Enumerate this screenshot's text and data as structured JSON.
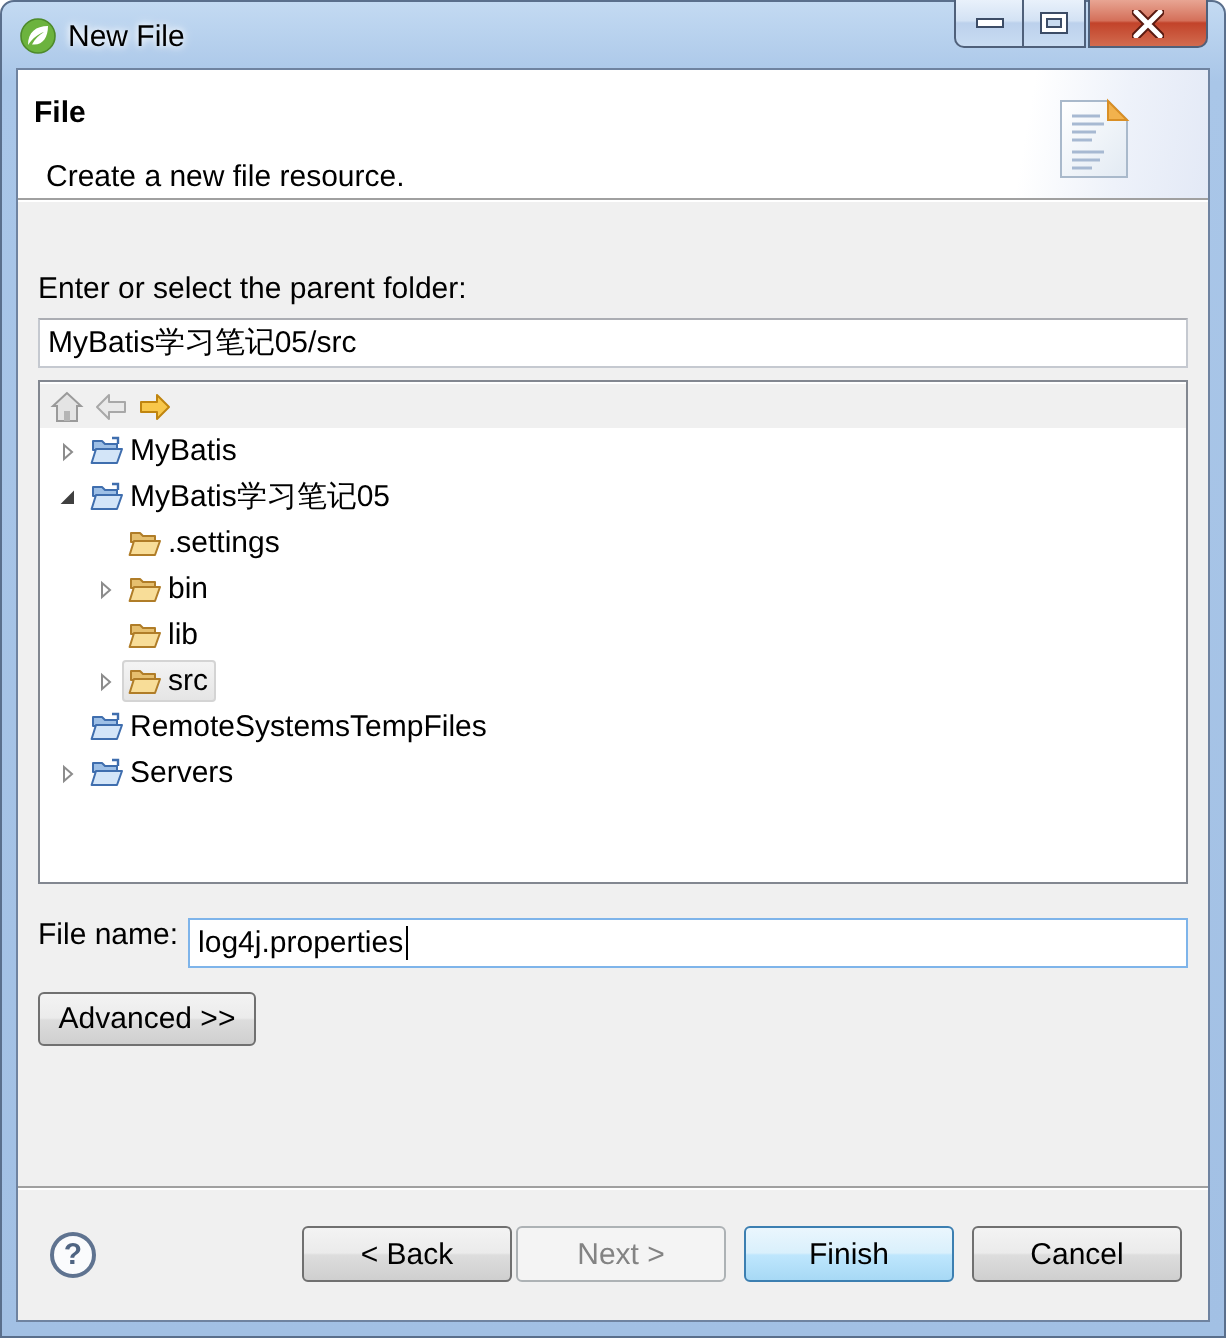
{
  "window": {
    "title": "New File"
  },
  "header": {
    "title": "File",
    "description": "Create a new file resource."
  },
  "parent_folder": {
    "label": "Enter or select the parent folder:",
    "value": "MyBatis学习笔记05/src",
    "focused": false
  },
  "tree": {
    "toolbar": [
      {
        "kind": "home",
        "disabled": true
      },
      {
        "kind": "back",
        "disabled": true
      },
      {
        "kind": "forward",
        "disabled": false
      }
    ],
    "items": [
      {
        "label": "MyBatis",
        "kind": "project",
        "expandable": true,
        "expanded": false,
        "selected": false
      },
      {
        "label": "MyBatis学习笔记05",
        "kind": "project",
        "expandable": true,
        "expanded": true,
        "selected": false,
        "children": [
          {
            "label": ".settings",
            "kind": "folder",
            "expandable": false,
            "selected": false
          },
          {
            "label": "bin",
            "kind": "folder",
            "expandable": true,
            "expanded": false,
            "selected": false
          },
          {
            "label": "lib",
            "kind": "folder",
            "expandable": false,
            "selected": false
          },
          {
            "label": "src",
            "kind": "folder",
            "expandable": true,
            "expanded": false,
            "selected": true
          }
        ]
      },
      {
        "label": "RemoteSystemsTempFiles",
        "kind": "project",
        "expandable": false,
        "selected": false
      },
      {
        "label": "Servers",
        "kind": "project",
        "expandable": true,
        "expanded": false,
        "selected": false
      }
    ]
  },
  "file_name": {
    "label": "File name:",
    "value": "log4j.properties",
    "focused": true
  },
  "advanced_button": {
    "label": "Advanced >>"
  },
  "help_button": {
    "label": "?"
  },
  "buttons": [
    {
      "label": "< Back",
      "disabled": false,
      "default": false
    },
    {
      "label": "Next >",
      "disabled": true,
      "default": false
    },
    {
      "label": "Finish",
      "disabled": false,
      "default": true
    },
    {
      "label": "Cancel",
      "disabled": false,
      "default": false
    }
  ]
}
